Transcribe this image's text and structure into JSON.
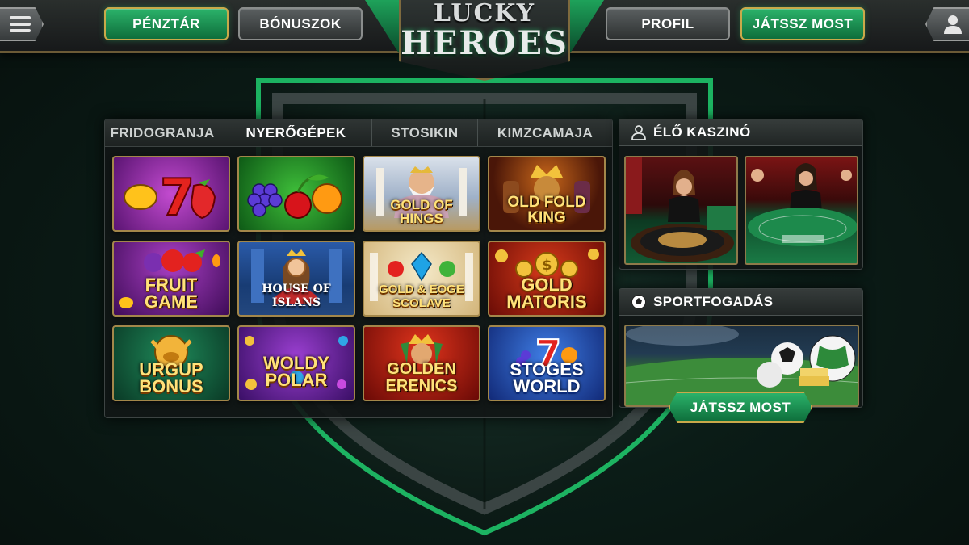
{
  "header": {
    "menu_icon": "hamburger-menu-icon",
    "cashier_label": "PÉNZTÁR",
    "bonuses_label": "BÓNUSZOK",
    "logo_top": "LUCKY",
    "logo_bottom": "HEROES",
    "profile_label": "PROFIL",
    "play_now_label": "JÁTSSZ MOST",
    "user_icon": "user-icon"
  },
  "tabs": [
    {
      "label": "FRIDOGRANJA",
      "active": false
    },
    {
      "label": "NYERŐGÉPEK",
      "active": true
    },
    {
      "label": "STOSIKIN",
      "active": false
    },
    {
      "label": "KIMZCAMAJA",
      "active": false
    }
  ],
  "games": [
    {
      "title": ""
    },
    {
      "title": ""
    },
    {
      "title": "GOLD OF HINGS"
    },
    {
      "title": "OLD FOLD KING"
    },
    {
      "title": "FRUIT GAME"
    },
    {
      "title": "HOUSE OF ISLANS"
    },
    {
      "title": "GOLD & EOGE SCOLAVE"
    },
    {
      "title": "GOLD MATORIS"
    },
    {
      "title": "URGUP BONUS"
    },
    {
      "title": "WOLDY POLAR"
    },
    {
      "title": "GOLDEN ERENICS"
    },
    {
      "title": "STOGES WORLD"
    }
  ],
  "live_casino": {
    "title": "ÉLŐ KASZINÓ",
    "icon": "dealer-icon"
  },
  "sports": {
    "title": "SPORTFOGADÁS",
    "icon": "soccer-ball-icon",
    "play_label": "JÁTSSZ MOST"
  },
  "colors": {
    "accent_green": "#1f9a55",
    "gold_border": "#c9a94a",
    "panel_bg": "#111616"
  }
}
